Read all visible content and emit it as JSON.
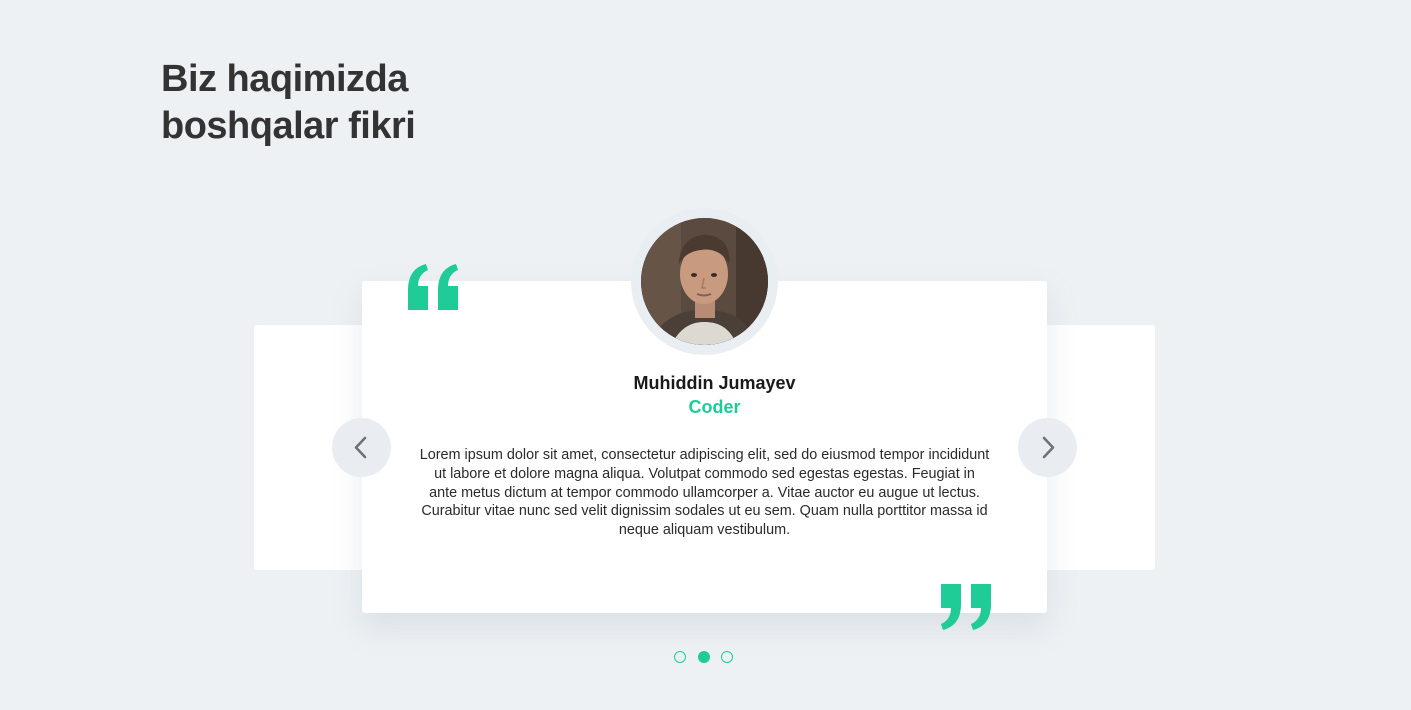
{
  "section": {
    "title": "Biz haqimizda boshqalar fikri"
  },
  "testimonial": {
    "name": "Muhiddin Jumayev",
    "role": "Coder",
    "text": "Lorem ipsum dolor sit amet, consectetur adipiscing elit, sed do eiusmod tempor incididunt ut labore et dolore magna aliqua. Volutpat commodo sed egestas egestas. Feugiat in ante metus dictum at tempor commodo ullamcorper a. Vitae auctor eu augue ut lectus. Curabitur vitae nunc sed velit dignissim sodales ut eu sem. Quam nulla porttitor massa id neque aliquam vestibulum.",
    "avatar_icon": "person-photo"
  },
  "carousel": {
    "prev_icon": "chevron-left-icon",
    "next_icon": "chevron-right-icon",
    "dot_count": 3,
    "active_index": 1
  },
  "colors": {
    "accent": "#1fcc98",
    "background": "#edf1f4",
    "card": "#ffffff",
    "title_text": "#333333"
  }
}
